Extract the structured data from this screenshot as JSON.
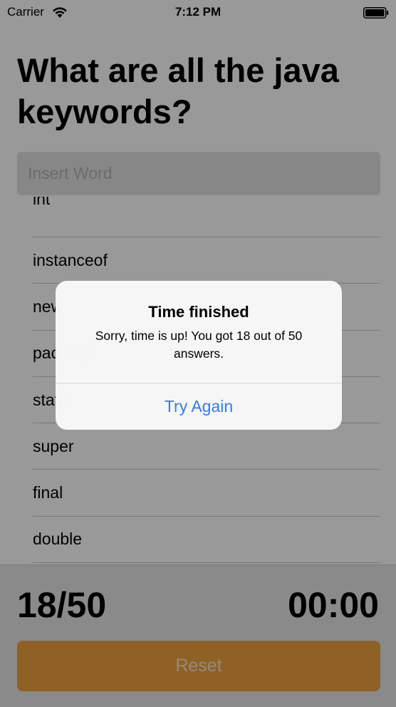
{
  "status_bar": {
    "carrier": "Carrier",
    "time": "7:12 PM"
  },
  "quiz": {
    "title": "What are all the java keywords?",
    "search_placeholder": "Insert Word",
    "words": [
      "int",
      "instanceof",
      "new",
      "package",
      "static",
      "super",
      "final",
      "double"
    ]
  },
  "footer": {
    "score": "18/50",
    "timer": "00:00",
    "reset_label": "Reset"
  },
  "alert": {
    "title": "Time finished",
    "message": "Sorry, time is up! You got 18 out of 50 answers.",
    "button_label": "Try Again"
  },
  "colors": {
    "accent_orange": "#f0a23f",
    "link_blue": "#2f7cf6"
  }
}
